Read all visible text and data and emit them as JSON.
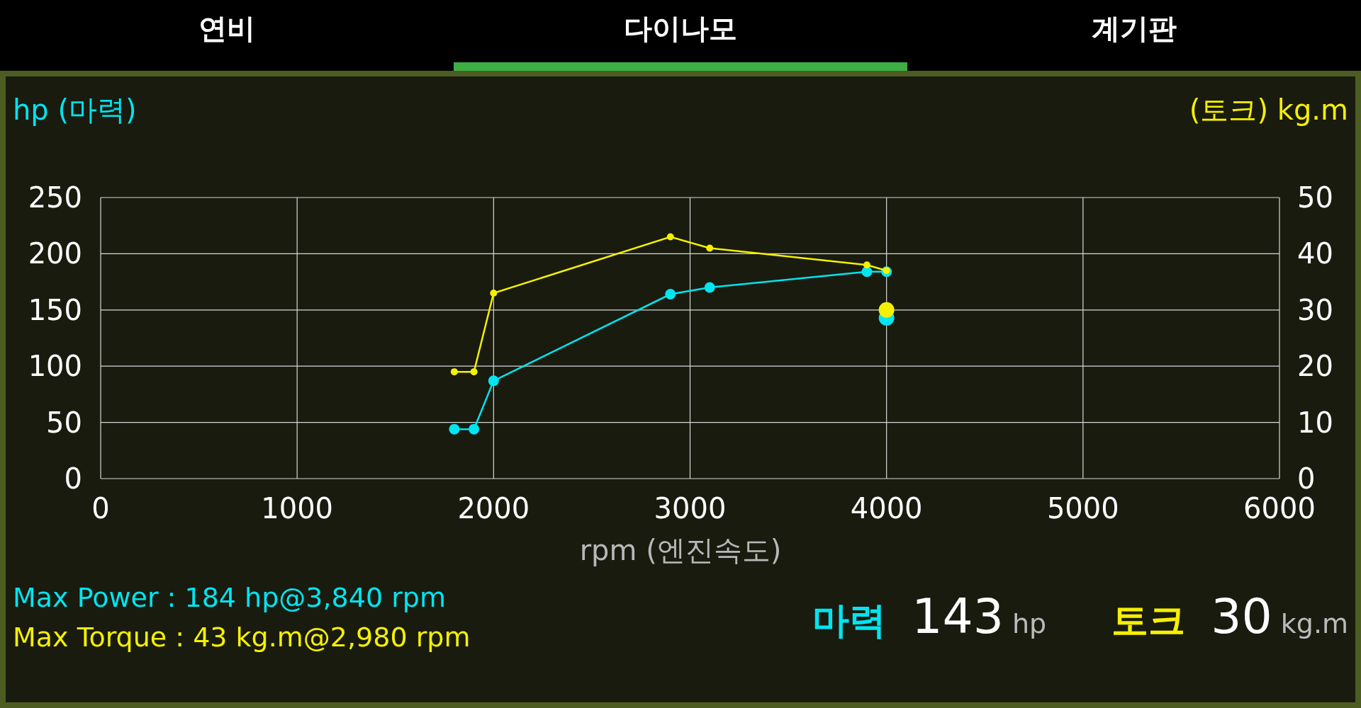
{
  "tabs": [
    {
      "label": "연비",
      "selected": false
    },
    {
      "label": "다이나모",
      "selected": true
    },
    {
      "label": "계기판",
      "selected": false
    }
  ],
  "charts": [
    {
      "chart_data": {
        "type": "line",
        "ylabel": "hp (마력)",
        "xlabel": "rpm (엔진속도)",
        "grid": true,
        "x": [
          1800,
          1900,
          2000,
          2900,
          3100,
          3900,
          4000
        ],
        "series": [
          {
            "color": "#00e5f0",
            "marker": "circle",
            "values": [
              44,
              44,
              87,
              164,
              170,
              184,
              184
            ]
          },
          {
            "color": "#00e5f0",
            "marker": "large-circle",
            "values": [
              null,
              null,
              null,
              null,
              null,
              null,
              143
            ]
          }
        ],
        "xlim": [
          0,
          6000
        ],
        "ylim": [
          0,
          250
        ],
        "xticks": [
          0,
          1000,
          2000,
          3000,
          4000,
          5000,
          6000
        ],
        "yticks": [
          0,
          50,
          100,
          150,
          200,
          250
        ]
      }
    },
    {
      "chart_data": {
        "type": "line",
        "ylabel": "(토크) kg.m",
        "x": [
          1800,
          1900,
          2000,
          2900,
          3100,
          3900,
          4000
        ],
        "series": [
          {
            "color": "#f5f000",
            "marker": "circle",
            "values": [
              19,
              19,
              33,
              43,
              41,
              38,
              37
            ]
          },
          {
            "color": "#f5f000",
            "marker": "large-circle",
            "values": [
              null,
              null,
              null,
              null,
              null,
              null,
              30
            ]
          }
        ],
        "xlim": [
          0,
          6000
        ],
        "ylim": [
          0,
          50
        ],
        "yticks": [
          0,
          10,
          20,
          30,
          40,
          50
        ]
      }
    }
  ],
  "max_lines": [
    {
      "text": "Max Power : 184 hp@3,840 rpm",
      "color": "#00e5f0"
    },
    {
      "text": "Max Torque : 43 kg.m@2,980 rpm",
      "color": "#f5f000"
    }
  ],
  "readings": [
    {
      "label": "마력",
      "value": "143",
      "unit": "hp",
      "color": "#00e5f0"
    },
    {
      "label": "토크",
      "value": "30",
      "unit": "kg.m",
      "color": "#f5f000"
    }
  ]
}
